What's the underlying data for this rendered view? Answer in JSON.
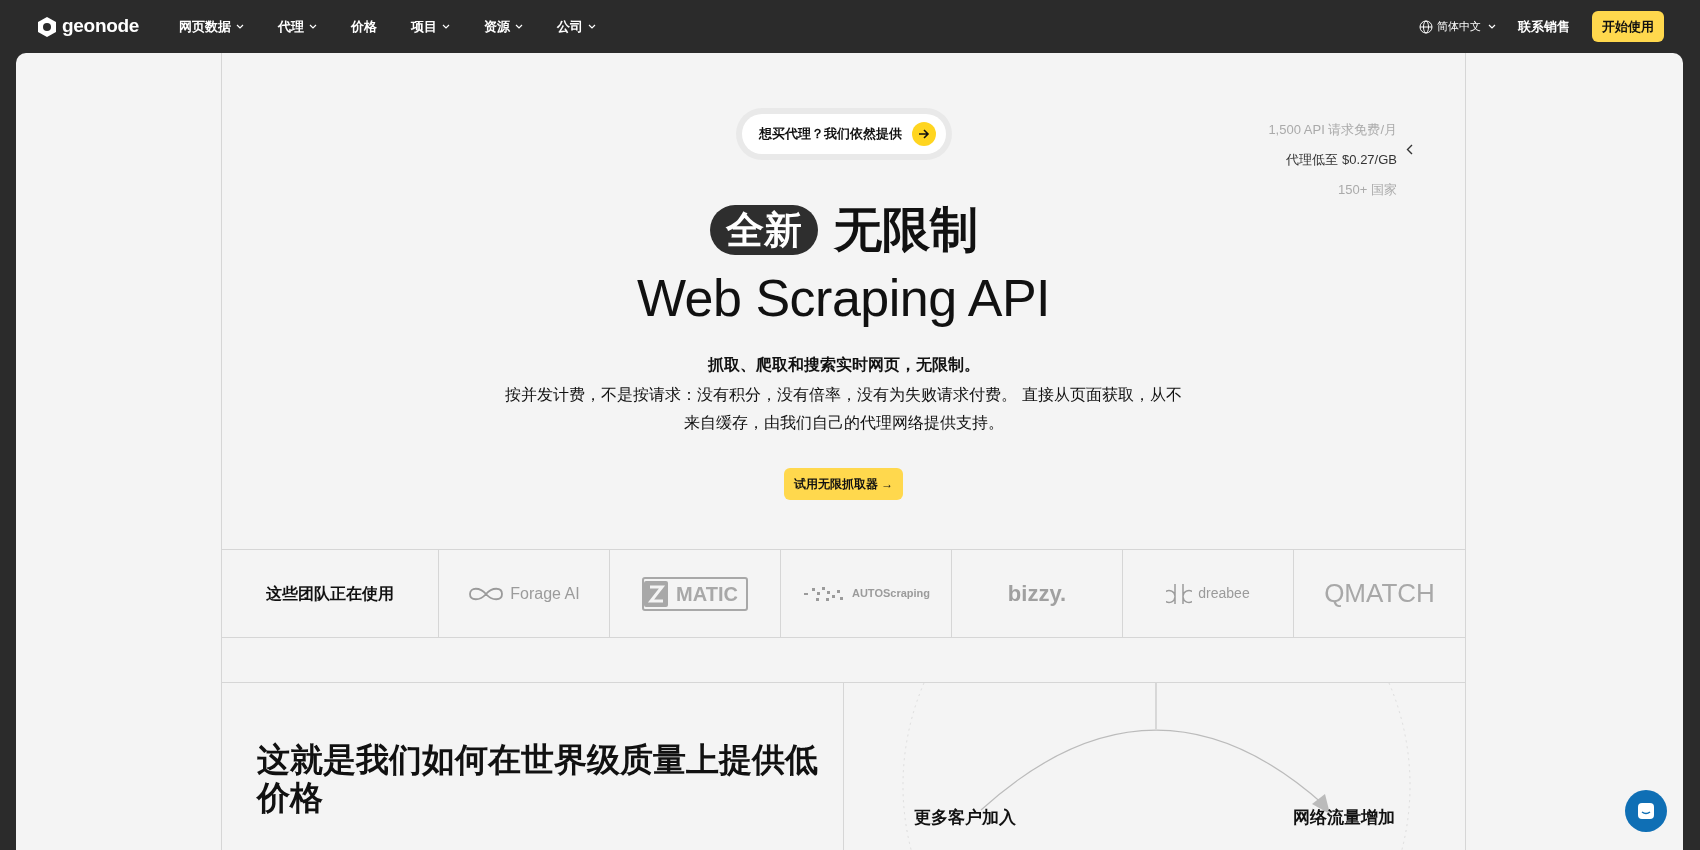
{
  "navbar": {
    "logo": "geonode",
    "menu": [
      {
        "label": "网页数据",
        "dropdown": true
      },
      {
        "label": "代理",
        "dropdown": true
      },
      {
        "label": "价格",
        "dropdown": false
      },
      {
        "label": "项目",
        "dropdown": true
      },
      {
        "label": "资源",
        "dropdown": true
      },
      {
        "label": "公司",
        "dropdown": true
      }
    ],
    "language": "简体中文",
    "contact": "联系销售",
    "cta": "开始使用"
  },
  "hero": {
    "announcement": "想买代理？我们依然提供",
    "stats": [
      "1,500 API 请求免费/月",
      "代理低至 $0.27/GB",
      "150+ 国家"
    ],
    "tag": "全新",
    "title_line_1": "无限制",
    "title_line_2": "Web Scraping API",
    "subtitle": "抓取、爬取和搜索实时网页，无限制。",
    "description": "按并发计费，不是按请求：没有积分，没有倍率，没有为失败请求付费。 直接从页面获取，从不来自缓存，由我们自己的代理网络提供支持。",
    "button": "试用无限抓取器 →"
  },
  "customers": {
    "label": "这些团队正在使用",
    "logos": [
      {
        "kind": "forage",
        "name": "Forage AI"
      },
      {
        "kind": "zmatic",
        "name": "MATIC"
      },
      {
        "kind": "autoscraping",
        "name": "AUTOScraping"
      },
      {
        "kind": "bizzy",
        "name": "bizzy."
      },
      {
        "kind": "dreabee",
        "name": "dreabee"
      },
      {
        "kind": "qmatch",
        "name": "QMATCH"
      }
    ]
  },
  "pricing": {
    "heading": "这就是我们如何在世界级质量上提供低价格",
    "cycle_labels": [
      "更多客户加入",
      "网络流量增加"
    ]
  }
}
